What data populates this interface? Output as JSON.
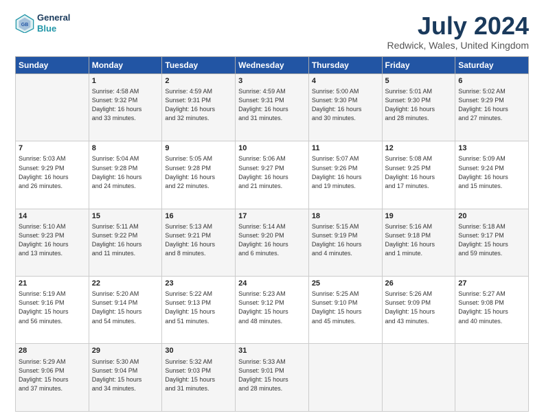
{
  "logo": {
    "line1": "General",
    "line2": "Blue"
  },
  "title": "July 2024",
  "subtitle": "Redwick, Wales, United Kingdom",
  "days_of_week": [
    "Sunday",
    "Monday",
    "Tuesday",
    "Wednesday",
    "Thursday",
    "Friday",
    "Saturday"
  ],
  "weeks": [
    [
      {
        "day": "",
        "content": ""
      },
      {
        "day": "1",
        "content": "Sunrise: 4:58 AM\nSunset: 9:32 PM\nDaylight: 16 hours\nand 33 minutes."
      },
      {
        "day": "2",
        "content": "Sunrise: 4:59 AM\nSunset: 9:31 PM\nDaylight: 16 hours\nand 32 minutes."
      },
      {
        "day": "3",
        "content": "Sunrise: 4:59 AM\nSunset: 9:31 PM\nDaylight: 16 hours\nand 31 minutes."
      },
      {
        "day": "4",
        "content": "Sunrise: 5:00 AM\nSunset: 9:30 PM\nDaylight: 16 hours\nand 30 minutes."
      },
      {
        "day": "5",
        "content": "Sunrise: 5:01 AM\nSunset: 9:30 PM\nDaylight: 16 hours\nand 28 minutes."
      },
      {
        "day": "6",
        "content": "Sunrise: 5:02 AM\nSunset: 9:29 PM\nDaylight: 16 hours\nand 27 minutes."
      }
    ],
    [
      {
        "day": "7",
        "content": "Sunrise: 5:03 AM\nSunset: 9:29 PM\nDaylight: 16 hours\nand 26 minutes."
      },
      {
        "day": "8",
        "content": "Sunrise: 5:04 AM\nSunset: 9:28 PM\nDaylight: 16 hours\nand 24 minutes."
      },
      {
        "day": "9",
        "content": "Sunrise: 5:05 AM\nSunset: 9:28 PM\nDaylight: 16 hours\nand 22 minutes."
      },
      {
        "day": "10",
        "content": "Sunrise: 5:06 AM\nSunset: 9:27 PM\nDaylight: 16 hours\nand 21 minutes."
      },
      {
        "day": "11",
        "content": "Sunrise: 5:07 AM\nSunset: 9:26 PM\nDaylight: 16 hours\nand 19 minutes."
      },
      {
        "day": "12",
        "content": "Sunrise: 5:08 AM\nSunset: 9:25 PM\nDaylight: 16 hours\nand 17 minutes."
      },
      {
        "day": "13",
        "content": "Sunrise: 5:09 AM\nSunset: 9:24 PM\nDaylight: 16 hours\nand 15 minutes."
      }
    ],
    [
      {
        "day": "14",
        "content": "Sunrise: 5:10 AM\nSunset: 9:23 PM\nDaylight: 16 hours\nand 13 minutes."
      },
      {
        "day": "15",
        "content": "Sunrise: 5:11 AM\nSunset: 9:22 PM\nDaylight: 16 hours\nand 11 minutes."
      },
      {
        "day": "16",
        "content": "Sunrise: 5:13 AM\nSunset: 9:21 PM\nDaylight: 16 hours\nand 8 minutes."
      },
      {
        "day": "17",
        "content": "Sunrise: 5:14 AM\nSunset: 9:20 PM\nDaylight: 16 hours\nand 6 minutes."
      },
      {
        "day": "18",
        "content": "Sunrise: 5:15 AM\nSunset: 9:19 PM\nDaylight: 16 hours\nand 4 minutes."
      },
      {
        "day": "19",
        "content": "Sunrise: 5:16 AM\nSunset: 9:18 PM\nDaylight: 16 hours\nand 1 minute."
      },
      {
        "day": "20",
        "content": "Sunrise: 5:18 AM\nSunset: 9:17 PM\nDaylight: 15 hours\nand 59 minutes."
      }
    ],
    [
      {
        "day": "21",
        "content": "Sunrise: 5:19 AM\nSunset: 9:16 PM\nDaylight: 15 hours\nand 56 minutes."
      },
      {
        "day": "22",
        "content": "Sunrise: 5:20 AM\nSunset: 9:14 PM\nDaylight: 15 hours\nand 54 minutes."
      },
      {
        "day": "23",
        "content": "Sunrise: 5:22 AM\nSunset: 9:13 PM\nDaylight: 15 hours\nand 51 minutes."
      },
      {
        "day": "24",
        "content": "Sunrise: 5:23 AM\nSunset: 9:12 PM\nDaylight: 15 hours\nand 48 minutes."
      },
      {
        "day": "25",
        "content": "Sunrise: 5:25 AM\nSunset: 9:10 PM\nDaylight: 15 hours\nand 45 minutes."
      },
      {
        "day": "26",
        "content": "Sunrise: 5:26 AM\nSunset: 9:09 PM\nDaylight: 15 hours\nand 43 minutes."
      },
      {
        "day": "27",
        "content": "Sunrise: 5:27 AM\nSunset: 9:08 PM\nDaylight: 15 hours\nand 40 minutes."
      }
    ],
    [
      {
        "day": "28",
        "content": "Sunrise: 5:29 AM\nSunset: 9:06 PM\nDaylight: 15 hours\nand 37 minutes."
      },
      {
        "day": "29",
        "content": "Sunrise: 5:30 AM\nSunset: 9:04 PM\nDaylight: 15 hours\nand 34 minutes."
      },
      {
        "day": "30",
        "content": "Sunrise: 5:32 AM\nSunset: 9:03 PM\nDaylight: 15 hours\nand 31 minutes."
      },
      {
        "day": "31",
        "content": "Sunrise: 5:33 AM\nSunset: 9:01 PM\nDaylight: 15 hours\nand 28 minutes."
      },
      {
        "day": "",
        "content": ""
      },
      {
        "day": "",
        "content": ""
      },
      {
        "day": "",
        "content": ""
      }
    ]
  ]
}
